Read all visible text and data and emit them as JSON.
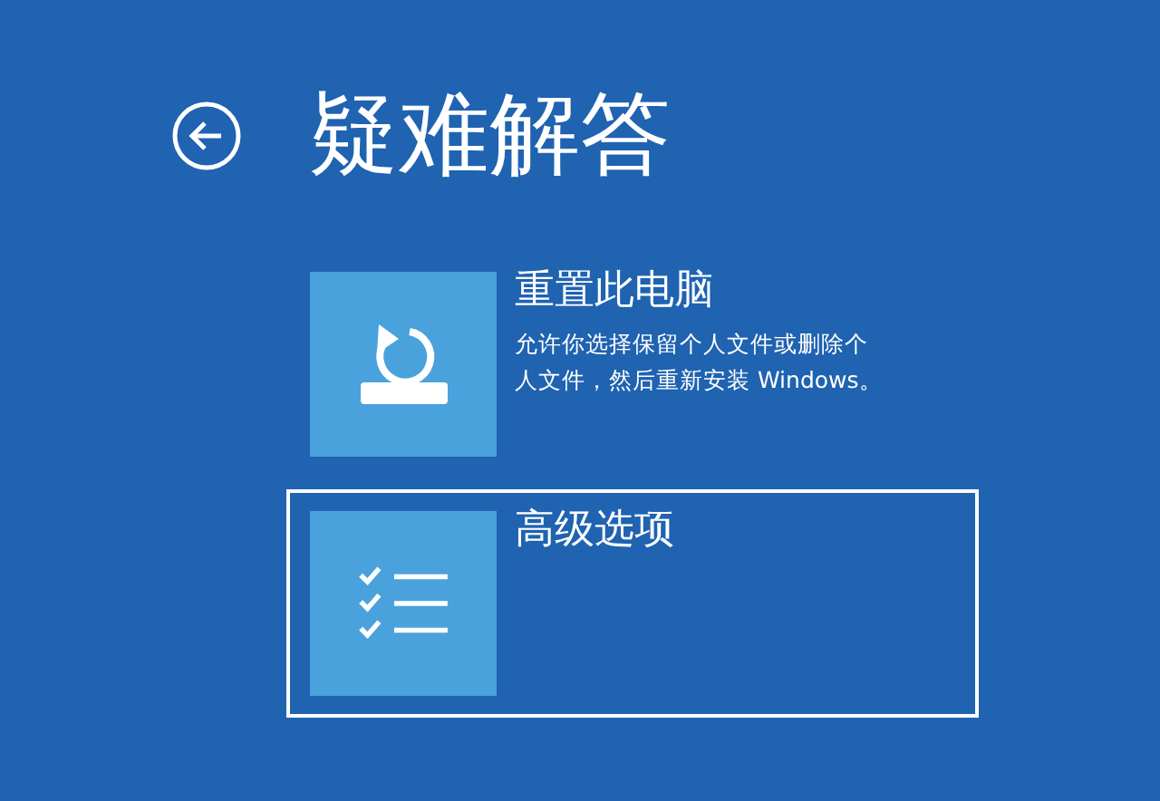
{
  "title": "疑难解答",
  "options": [
    {
      "kind": "reset",
      "title": "重置此电脑",
      "description": "允许你选择保留个人文件或删除个人文件，然后重新安装 Windows。",
      "selected": false
    },
    {
      "kind": "advanced",
      "title": "高级选项",
      "selected": true
    }
  ]
}
